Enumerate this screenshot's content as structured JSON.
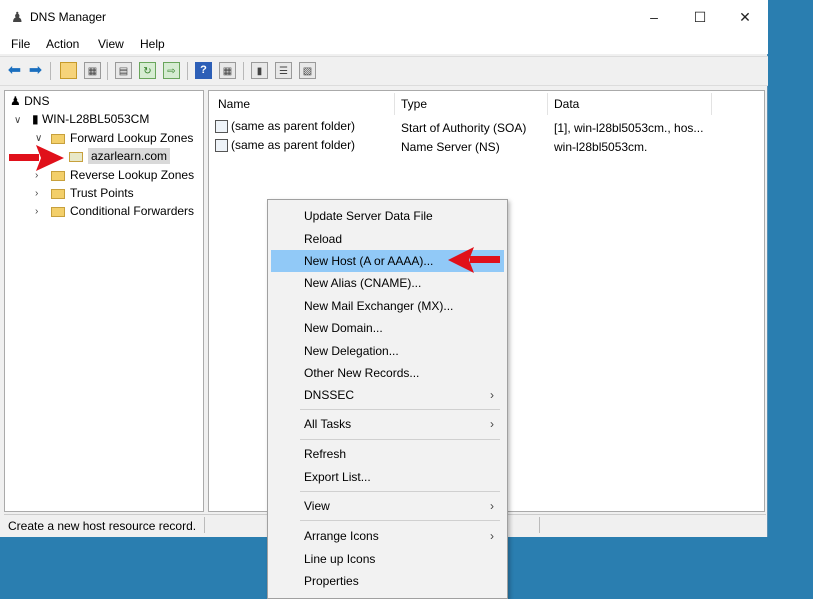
{
  "window": {
    "title": "DNS Manager",
    "minimize_icon": "minimize-icon",
    "maximize_icon": "maximize-icon",
    "close_icon": "close-icon"
  },
  "menubar": [
    "File",
    "Action",
    "View",
    "Help"
  ],
  "tree": {
    "root": "DNS",
    "server": "WIN-L28BL5053CM",
    "forward": "Forward Lookup Zones",
    "zone": "azarlearn.com",
    "reverse": "Reverse Lookup Zones",
    "trust": "Trust Points",
    "conditional": "Conditional Forwarders"
  },
  "list": {
    "columns": [
      "Name",
      "Type",
      "Data"
    ],
    "rows": [
      {
        "name": "(same as parent folder)",
        "type": "Start of Authority (SOA)",
        "data": "[1], win-l28bl5053cm., hos..."
      },
      {
        "name": "(same as parent folder)",
        "type": "Name Server (NS)",
        "data": "win-l28bl5053cm."
      }
    ]
  },
  "status": "Create a new host resource record.",
  "context_menu": {
    "items": [
      "Update Server Data File",
      "Reload",
      "New Host (A or AAAA)...",
      "New Alias (CNAME)...",
      "New Mail Exchanger (MX)...",
      "New Domain...",
      "New Delegation...",
      "Other New Records...",
      "DNSSEC",
      "All Tasks",
      "Refresh",
      "Export List...",
      "View",
      "Arrange Icons",
      "Line up Icons",
      "Properties"
    ],
    "highlighted": "New Host (A or AAAA)..."
  },
  "colors": {
    "desktop": "#2a7eb0",
    "highlight": "#91c9f7",
    "annotation_arrow": "#e0101a"
  }
}
